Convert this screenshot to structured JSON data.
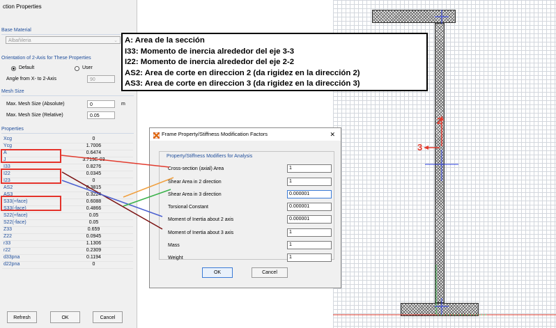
{
  "left_panel": {
    "title": "ction Properties",
    "base_material_heading": "Base Material",
    "material_value": "Albañileria",
    "orientation_heading": "Orientation of 2-Axis for These Properties",
    "radio_default_label": "Default",
    "radio_user_label": "User",
    "angle_label": "Angle from X- to 2-Axis",
    "angle_value": "90",
    "mesh_heading": "Mesh Size",
    "mesh_abs_label": "Max. Mesh Size (Absolute)",
    "mesh_abs_value": "0",
    "mesh_abs_unit": "m",
    "mesh_rel_label": "Max. Mesh Size (Relative)",
    "mesh_rel_value": "0.05",
    "properties_heading": "Properties",
    "properties": [
      {
        "name": "Xcg",
        "value": "0"
      },
      {
        "name": "Ycg",
        "value": "1.7006"
      },
      {
        "name": "A",
        "value": "0.6474"
      },
      {
        "name": "J",
        "value": "3.719E-03"
      },
      {
        "name": "I33",
        "value": "0.8276"
      },
      {
        "name": "I22",
        "value": "0.0345"
      },
      {
        "name": "I23",
        "value": "0"
      },
      {
        "name": "AS2",
        "value": "0.3815"
      },
      {
        "name": "AS3",
        "value": "0.3224"
      },
      {
        "name": "S33(+face)",
        "value": "0.6088"
      },
      {
        "name": "S33(-face)",
        "value": "0.4866"
      },
      {
        "name": "S22(+face)",
        "value": "0.05"
      },
      {
        "name": "S22(-face)",
        "value": "0.05"
      },
      {
        "name": "Z33",
        "value": "0.659"
      },
      {
        "name": "Z22",
        "value": "0.0945"
      },
      {
        "name": "r33",
        "value": "1.1306"
      },
      {
        "name": "r22",
        "value": "0.2309"
      },
      {
        "name": "d33pna",
        "value": "0.1194"
      },
      {
        "name": "d22pna",
        "value": "0"
      }
    ],
    "refresh_label": "Refresh",
    "ok_label": "OK",
    "cancel_label": "Cancel"
  },
  "annotation": {
    "lines": [
      "A: Area de la sección",
      "I33: Momento de inercia alrededor del eje 3-3",
      "I22: Momento de inercia alrededor del eje 2-2",
      "AS2: Area de corte en direccion 2 (da rigidez en la dirección 2)",
      "AS3: Area de corte en direccion 3 (da rigidez en la dirección 3)"
    ]
  },
  "dialog": {
    "title": "Frame Property/Stiffness Modification Factors",
    "close_glyph": "✕",
    "group_title": "Property/Stiffness Modifiers for Analysis",
    "rows": [
      {
        "label": "Cross-section (axial) Area",
        "value": "1"
      },
      {
        "label": "Shear Area in 2 direction",
        "value": "1"
      },
      {
        "label": "Shear Area in 3 direction",
        "value": "0.000001"
      },
      {
        "label": "Torsional Constant",
        "value": "0.000001"
      },
      {
        "label": "Moment of Inertia about 2 axis",
        "value": "0.000001"
      },
      {
        "label": "Moment of Inertia about 3 axis",
        "value": "1"
      },
      {
        "label": "Mass",
        "value": "1"
      },
      {
        "label": "Weight",
        "value": "1"
      }
    ],
    "ok_label": "OK",
    "cancel_label": "Cancel"
  },
  "canvas": {
    "axis_2_label": "2",
    "axis_3_label": "3"
  },
  "colors": {
    "highlight_red": "#e4332b",
    "panel_blue": "#1f4e9c",
    "line_red": "#e23b2e",
    "line_orange": "#f0a040",
    "line_blue": "#4a5fd0",
    "line_green": "#3ab24a",
    "line_darkred": "#7a1010"
  }
}
